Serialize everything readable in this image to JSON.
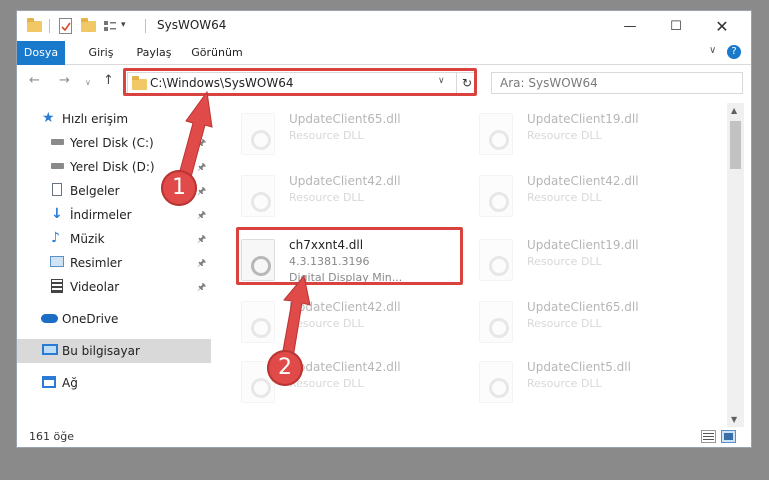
{
  "window": {
    "title": "SysWOW64"
  },
  "ribbon": {
    "tabs": [
      "Dosya",
      "Giriş",
      "Paylaş",
      "Görünüm"
    ]
  },
  "navbar": {
    "address": "C:\\Windows\\SysWOW64",
    "search_placeholder": "Ara: SysWOW64"
  },
  "sidebar": {
    "items": [
      {
        "label": "Hızlı erişim",
        "icon": "star-icon"
      },
      {
        "label": "Yerel Disk (C:)",
        "icon": "drive-icon"
      },
      {
        "label": "Yerel Disk (D:)",
        "icon": "drive-icon"
      },
      {
        "label": "Belgeler",
        "icon": "document-icon"
      },
      {
        "label": "İndirmeler",
        "icon": "download-icon"
      },
      {
        "label": "Müzik",
        "icon": "music-icon"
      },
      {
        "label": "Resimler",
        "icon": "pictures-icon"
      },
      {
        "label": "Videolar",
        "icon": "video-icon"
      },
      {
        "label": "OneDrive",
        "icon": "cloud-icon"
      },
      {
        "label": "Bu bilgisayar",
        "icon": "computer-icon"
      },
      {
        "label": "Ağ",
        "icon": "network-icon"
      }
    ]
  },
  "files": [
    {
      "name": "UpdateClient65.dll",
      "type": "Resource DLL"
    },
    {
      "name": "UpdateClient19.dll",
      "type": "Resource DLL"
    },
    {
      "name": "UpdateClient42.dll",
      "type": "Resource DLL"
    },
    {
      "name": "UpdateClient42.dll",
      "type": "Resource DLL"
    },
    {
      "name": "ch7xxnt4.dll",
      "version": "4.3.1381.3196",
      "desc": "Digital Display Min..."
    },
    {
      "name": "UpdateClient19.dll",
      "type": "Resource DLL"
    },
    {
      "name": "UpdateClient42.dll",
      "type": "Resource DLL"
    },
    {
      "name": "UpdateClient65.dll",
      "type": "Resource DLL"
    },
    {
      "name": "UpdateClient42.dll",
      "type": "Resource DLL"
    },
    {
      "name": "UpdateClient5.dll",
      "type": "Resource DLL"
    }
  ],
  "status": {
    "count": "161 öğe"
  },
  "annotations": {
    "step1": "1",
    "step2": "2"
  },
  "colors": {
    "accent": "#1979ca",
    "highlight": "#d9423f"
  }
}
